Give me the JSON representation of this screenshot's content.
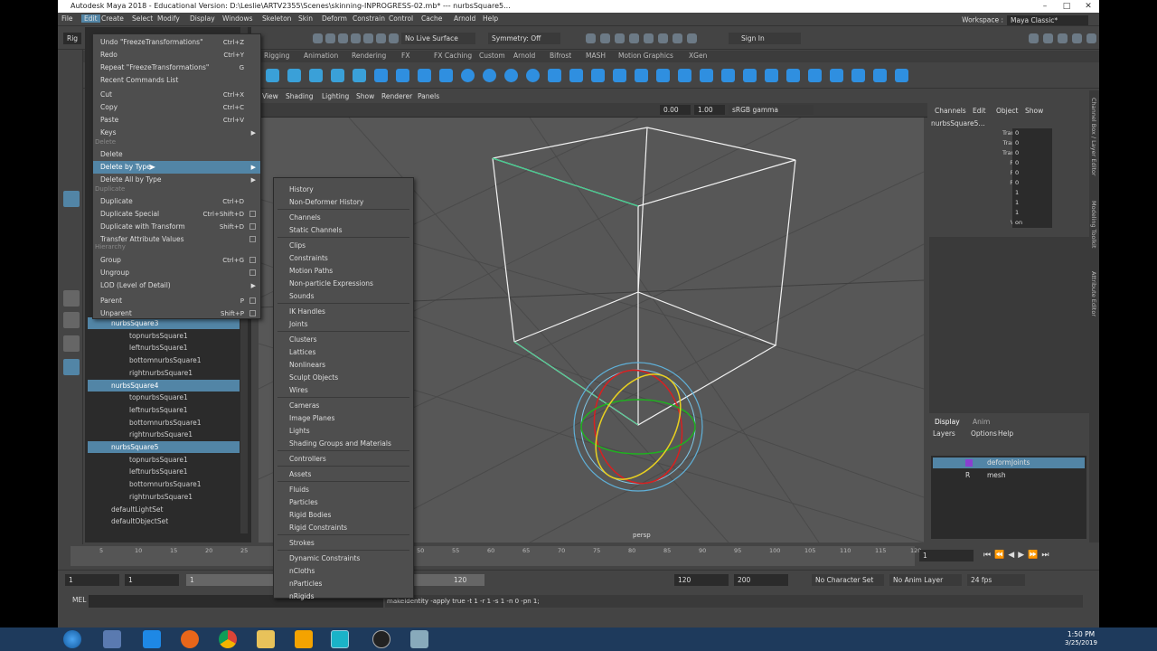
{
  "window": {
    "title": "Autodesk Maya 2018 - Educational Version: D:\\Leslie\\ARTV2355\\Scenes\\skinning-INPROGRESS-02.mb* --- nurbsSquare5..."
  },
  "menubar": [
    "File",
    "Edit",
    "Create",
    "Select",
    "Modify",
    "Display",
    "Windows",
    "Skeleton",
    "Skin",
    "Deform",
    "Constrain",
    "Control",
    "Cache",
    "Arnold",
    "Help"
  ],
  "workspace": {
    "label": "Workspace :",
    "value": "Maya Classic*"
  },
  "statusline": {
    "live_surface": "No Live Surface",
    "symmetry": "Symmetry: Off",
    "sign_in": "Sign In",
    "mode": "Rig"
  },
  "shelf_tabs": [
    "Rigging",
    "Animation",
    "Rendering",
    "FX",
    "FX Caching",
    "Custom",
    "Arnold",
    "Bifrost",
    "MASH",
    "Motion Graphics",
    "XGen"
  ],
  "edit_menu": {
    "items": [
      {
        "label": "Undo \"FreezeTransformations\"",
        "shortcut": "Ctrl+Z"
      },
      {
        "label": "Redo",
        "shortcut": "Ctrl+Y"
      },
      {
        "label": "Repeat \"FreezeTransformations\"",
        "shortcut": "G"
      },
      {
        "label": "Recent Commands List",
        "shortcut": ""
      },
      {
        "label": "Cut",
        "shortcut": "Ctrl+X"
      },
      {
        "label": "Copy",
        "shortcut": "Ctrl+C"
      },
      {
        "label": "Paste",
        "shortcut": "Ctrl+V"
      },
      {
        "label": "Keys",
        "shortcut": ""
      },
      {
        "label": "Delete",
        "shortcut": ""
      },
      {
        "label": "Delete by Type",
        "shortcut": ""
      },
      {
        "label": "Delete All by Type",
        "shortcut": ""
      },
      {
        "label": "Duplicate",
        "shortcut": "Ctrl+D"
      },
      {
        "label": "Duplicate Special",
        "shortcut": "Ctrl+Shift+D"
      },
      {
        "label": "Duplicate with Transform",
        "shortcut": "Shift+D"
      },
      {
        "label": "Transfer Attribute Values",
        "shortcut": ""
      },
      {
        "label": "Group",
        "shortcut": "Ctrl+G"
      },
      {
        "label": "Ungroup",
        "shortcut": ""
      },
      {
        "label": "LOD (Level of Detail)",
        "shortcut": ""
      },
      {
        "label": "Parent",
        "shortcut": "P"
      },
      {
        "label": "Unparent",
        "shortcut": "Shift+P"
      }
    ],
    "headers": [
      "Delete",
      "Duplicate",
      "Hierarchy"
    ]
  },
  "submenu": [
    "History",
    "Non-Deformer History",
    "Channels",
    "Static Channels",
    "Clips",
    "Constraints",
    "Motion Paths",
    "Non-particle Expressions",
    "Sounds",
    "IK Handles",
    "Joints",
    "Clusters",
    "Lattices",
    "Nonlinears",
    "Sculpt Objects",
    "Wires",
    "Cameras",
    "Image Planes",
    "Lights",
    "Shading Groups and Materials",
    "Controllers",
    "Assets",
    "Fluids",
    "Particles",
    "Rigid Bodies",
    "Rigid Constraints",
    "Strokes",
    "Dynamic Constraints",
    "nCloths",
    "nParticles",
    "nRigids"
  ],
  "outliner": [
    {
      "label": "nurbsSquare3",
      "sel": true,
      "indent": 1
    },
    {
      "label": "topnurbsSquare1",
      "sel": false,
      "indent": 2
    },
    {
      "label": "leftnurbsSquare1",
      "sel": false,
      "indent": 2
    },
    {
      "label": "bottomnurbsSquare1",
      "sel": false,
      "indent": 2
    },
    {
      "label": "rightnurbsSquare1",
      "sel": false,
      "indent": 2
    },
    {
      "label": "nurbsSquare4",
      "sel": true,
      "indent": 1
    },
    {
      "label": "topnurbsSquare1",
      "sel": false,
      "indent": 2
    },
    {
      "label": "leftnurbsSquare1",
      "sel": false,
      "indent": 2
    },
    {
      "label": "bottomnurbsSquare1",
      "sel": false,
      "indent": 2
    },
    {
      "label": "rightnurbsSquare1",
      "sel": false,
      "indent": 2
    },
    {
      "label": "nurbsSquare5",
      "sel": true,
      "indent": 1
    },
    {
      "label": "topnurbsSquare1",
      "sel": false,
      "indent": 2
    },
    {
      "label": "leftnurbsSquare1",
      "sel": false,
      "indent": 2
    },
    {
      "label": "bottomnurbsSquare1",
      "sel": false,
      "indent": 2
    },
    {
      "label": "rightnurbsSquare1",
      "sel": false,
      "indent": 2
    },
    {
      "label": "defaultLightSet",
      "sel": false,
      "indent": 1
    },
    {
      "label": "defaultObjectSet",
      "sel": false,
      "indent": 1
    }
  ],
  "viewport": {
    "menu": [
      "View",
      "Shading",
      "Lighting",
      "Show",
      "Renderer",
      "Panels"
    ],
    "exposure": "0.00",
    "gamma": "1.00",
    "colorspace": "sRGB gamma",
    "camera": "persp"
  },
  "channelbox": {
    "tabs": [
      "Channels",
      "Edit",
      "Object",
      "Show"
    ],
    "object": "nurbsSquare5...",
    "attrs": [
      {
        "k": "Translate X",
        "v": "0"
      },
      {
        "k": "Translate Y",
        "v": "0"
      },
      {
        "k": "Translate Z",
        "v": "0"
      },
      {
        "k": "Rotate X",
        "v": "0"
      },
      {
        "k": "Rotate Y",
        "v": "0"
      },
      {
        "k": "Rotate Z",
        "v": "0"
      },
      {
        "k": "Scale X",
        "v": "1"
      },
      {
        "k": "Scale Y",
        "v": "1"
      },
      {
        "k": "Scale Z",
        "v": "1"
      },
      {
        "k": "Visibility",
        "v": "on"
      }
    ],
    "side_tabs": [
      "Channel Box / Layer Editor",
      "Modeling Toolkit",
      "Attribute Editor"
    ]
  },
  "layers": {
    "tabs": [
      "Display",
      "Anim"
    ],
    "menu": [
      "Layers",
      "Options",
      "Help"
    ],
    "rows": [
      {
        "name": "deformJoints",
        "flag": "",
        "sel": true
      },
      {
        "name": "mesh",
        "flag": "R",
        "sel": false
      }
    ]
  },
  "timeline": {
    "ticks": [
      "5",
      "10",
      "15",
      "20",
      "25",
      "30",
      "35",
      "40",
      "45",
      "50",
      "55",
      "60",
      "65",
      "70",
      "75",
      "80",
      "85",
      "90",
      "95",
      "100",
      "105",
      "110",
      "115",
      "120"
    ],
    "current": "1",
    "range_start": "1",
    "range_start2": "1",
    "range_handle": "1",
    "range_end_handle": "120",
    "range_end": "120",
    "anim_end": "200",
    "char_set": "No Character Set",
    "anim_layer": "No Anim Layer",
    "fps": "24 fps"
  },
  "cmdline": {
    "lang": "MEL",
    "text": "makeIdentity -apply true -t 1 -r 1 -s 1 -n 0 -pn 1;"
  },
  "taskbar": {
    "time": "1:50 PM",
    "date": "3/25/2019"
  }
}
